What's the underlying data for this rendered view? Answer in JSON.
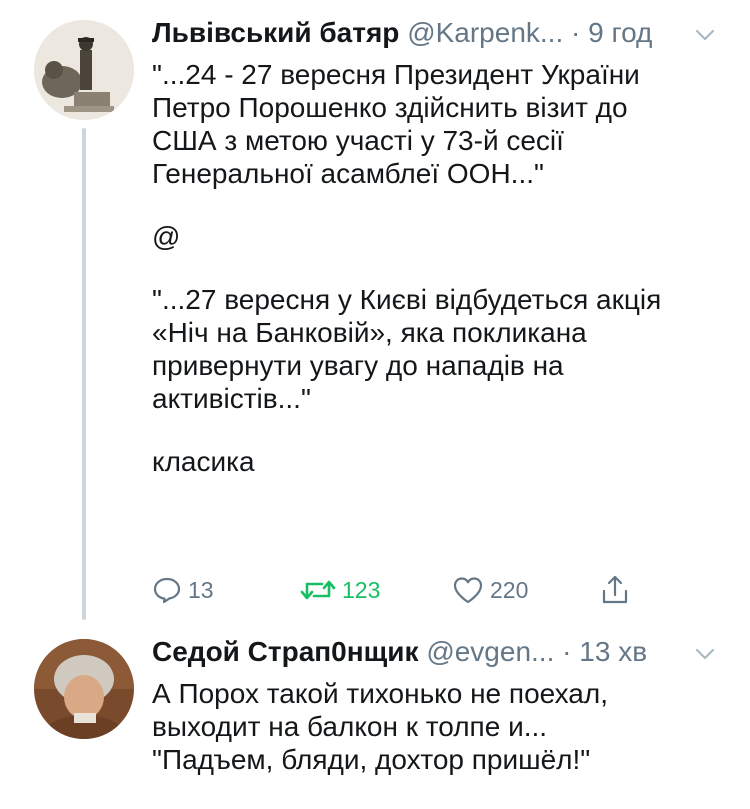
{
  "tweets": [
    {
      "author_name": "Львівський батяр",
      "author_handle": "@Karpenk...",
      "dot": "·",
      "time": "9 год",
      "paragraphs": [
        "\"...24 - 27 вересня Президент України\nПетро Порошенко здійснить візит до\nСША з метою участі у 73-й сесії\nГенеральної асамблеї ООН...\"",
        "@",
        "\"...27 вересня у Києві відбудеться акція\n«Ніч на Банковій», яка покликана\nпривернути увагу до нападів на\nактивістів...\"",
        "класика"
      ],
      "actions": {
        "reply_count": "13",
        "retweet_count": "123",
        "like_count": "220"
      },
      "colors": {
        "retweet_active": "#17bf63",
        "muted": "#657786"
      }
    },
    {
      "author_name": "Седой Страп0нщик",
      "author_handle": "@evgen...",
      "dot": "·",
      "time": "13 хв",
      "paragraphs": [
        "А Порох такой тихонько не поехал,\nвыходит на балкон к толпе и...\n\"Падъем, бляди, дохтор пришёл!\""
      ]
    }
  ],
  "icons": {
    "reply": "reply-icon",
    "retweet": "retweet-icon",
    "like": "heart-icon",
    "share": "share-icon",
    "caret": "chevron-down-icon"
  }
}
